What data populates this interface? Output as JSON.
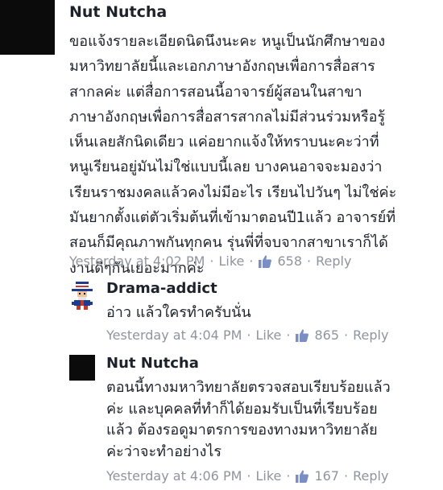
{
  "comments": [
    {
      "author": "Nut Nutcha",
      "avatar": "black-square-avatar",
      "text": "ขอแจ้งรายละเอียดนิดนึงนะคะ หนูเป็นนักศึกษาของ\nมหาวิทยาลัยนี้และเอกภาษาอังกฤษเพื่อการสื่อสาร\nสากลค่ะ แต่สื่อการสอนนี้อาจารย์ผู้สอนในสาขา\nภาษาอังกฤษเพื่อการสื่อสารสากลไม่มีส่วนร่วมหรือรู้\nเห็นเลยสักนิดเดียว แค่อยากแจ้งให้ทราบนะคะว่าที่\nหนูเรียนอยู่มันไม่ใช่แบบนี้เลย บางคนอาจจะมองว่า\nเรียนราชมงคลแล้วคงไม่มีอะไร เรียนไปวันๆ ไม่ใช่ค่ะ\nมันยากตั้งแต่ตัวเริ่มต้นที่เข้ามาตอนปี1แล้ว อาจารย์ที่\nสอนก็มีคุณภาพกันทุกคน รุ่นพี่ที่จบจากสาขาเราก็ได้\nงานดีๆกันเยอะมากค่ะ",
      "time": "Yesterday at 4:02 PM",
      "like_label": "Like",
      "like_count": "658",
      "reply_label": "Reply",
      "separator": "·"
    },
    {
      "author": "Drama-addict",
      "avatar": "uncle-sam-avatar",
      "text": "อ่าว แล้วใครทำครับนั่น",
      "time": "Yesterday at 4:04 PM",
      "like_label": "Like",
      "like_count": "865",
      "reply_label": "Reply",
      "separator": "·"
    },
    {
      "author": "Nut Nutcha",
      "avatar": "black-square-avatar",
      "text": "ตอนนี้ทางมหาวิทยาลัยตรวจสอบเรียบร้อยแล้ว\nค่ะ และบุคคลที่ทำก็ได้ยอมรับเป็นที่เรียบร้อย\nแล้ว ต้องรอดูมาตรการของทางมหาวิทยาลัย\nค่ะว่าจะทำอย่างไร",
      "time": "Yesterday at 4:06 PM",
      "like_label": "Like",
      "like_count": "167",
      "reply_label": "Reply",
      "separator": "·"
    }
  ],
  "colors": {
    "meta_gray": "#90949c",
    "text": "#1d2129",
    "like_icon": "#7a8ec4"
  },
  "icons": {
    "like": "thumbs-up-icon"
  }
}
